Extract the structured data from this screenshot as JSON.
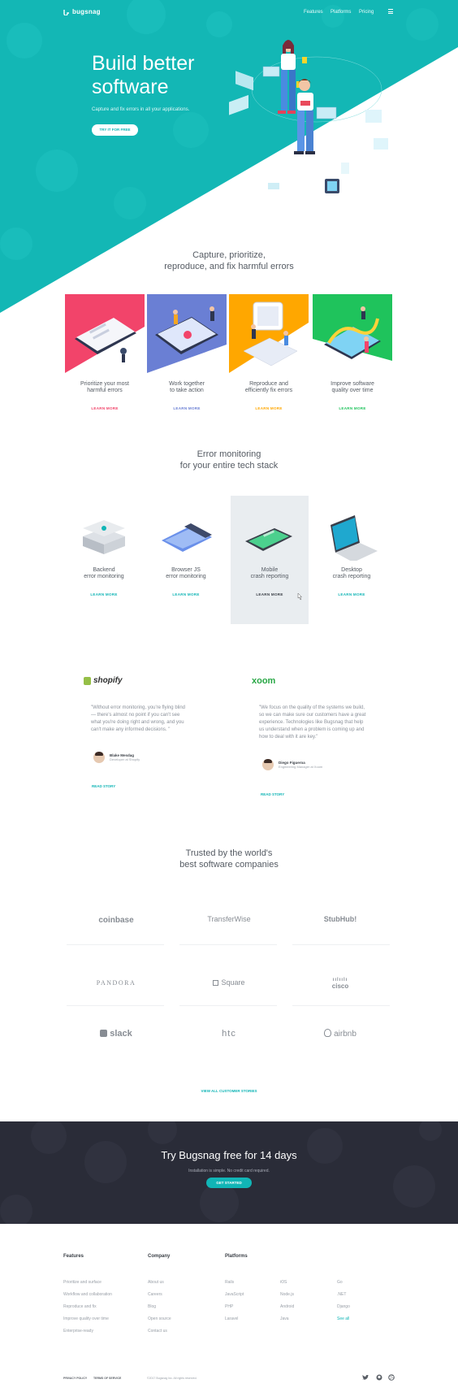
{
  "brand": {
    "name": "bugsnag",
    "accent": "#11b5b6",
    "dark": "#2a2c38"
  },
  "nav": {
    "links": [
      "Features",
      "Platforms",
      "Pricing"
    ],
    "menu_icon": "mail-icon"
  },
  "hero": {
    "title_line1": "Build better",
    "title_line2": "software",
    "subtitle": "Capture and fix errors in all your applications.",
    "cta": "TRY IT FOR FREE"
  },
  "features_section": {
    "title_line1": "Capture, prioritize,",
    "title_line2": "reproduce, and fix harmful errors"
  },
  "features": [
    {
      "line1": "Prioritize your most",
      "line2": "harmful errors",
      "link": "LEARN MORE",
      "color": "#f2446a"
    },
    {
      "line1": "Work together",
      "line2": "to take action",
      "link": "LEARN MORE",
      "color": "#6a7fd4"
    },
    {
      "line1": "Reproduce and",
      "line2": "efficiently fix errors",
      "link": "LEARN MORE",
      "color": "#ffa700"
    },
    {
      "line1": "Improve software",
      "line2": "quality over time",
      "link": "LEARN MORE",
      "color": "#1fc35c"
    }
  ],
  "tech_section": {
    "title_line1": "Error monitoring",
    "title_line2": "for your entire tech stack"
  },
  "tech": [
    {
      "line1": "Backend",
      "line2": "error monitoring",
      "link": "LEARN MORE"
    },
    {
      "line1": "Browser JS",
      "line2": "error monitoring",
      "link": "LEARN MORE"
    },
    {
      "line1": "Mobile",
      "line2": "crash reporting",
      "link": "LEARN MORE"
    },
    {
      "line1": "Desktop",
      "line2": "crash reporting",
      "link": "LEARN MORE"
    }
  ],
  "testimonials": [
    {
      "company": "shopify",
      "quote": "\"Without error monitoring, you're flying blind — there's almost no point if you can't see what you're doing right and wrong, and you can't make any informed decisions. \"",
      "name": "Blake Mesdag",
      "role": "Developer at Shopify",
      "link": "READ STORY"
    },
    {
      "company": "xoom",
      "quote": "\"We focus on the quality of the systems we build, so we can make sure our customers have a great experience. Technologies like Bugsnag that help us understand when a problem is coming up and how to deal with it are key.\"",
      "name": "Diego Figueroa",
      "role": "Engineering Manager at Xoom",
      "link": "READ STORY"
    }
  ],
  "trusted_section": {
    "title_line1": "Trusted by the world's",
    "title_line2": "best software companies"
  },
  "logos": [
    "coinbase",
    "TransferWise",
    "StubHub!",
    "PANDORA",
    "Square",
    "cisco",
    "slack",
    "htc",
    "airbnb"
  ],
  "view_all": "VIEW ALL CUSTOMER STORIES",
  "cta": {
    "title": "Try Bugsnag free for 14 days",
    "subtitle": "Installation is simple. No credit card required.",
    "button": "GET STARTED"
  },
  "footer": {
    "features_heading": "Features",
    "features": [
      "Prioritize and surface",
      "Workflow and collaboration",
      "Reproduce and fix",
      "Improve quality over time",
      "Enterprise-ready"
    ],
    "company_heading": "Company",
    "company": [
      "About us",
      "Careers",
      "Blog",
      "Open source",
      "Contact us"
    ],
    "platforms_heading": "Platforms",
    "platforms_col1": [
      "Rails",
      "JavaScript",
      "PHP",
      "Laravel"
    ],
    "platforms_col2": [
      "iOS",
      "Node.js",
      "Android",
      "Java"
    ],
    "platforms_col3": [
      "Go",
      ".NET",
      "Django",
      "See all"
    ],
    "privacy": "PRIVACY POLICY",
    "terms": "TERMS OF SERVICE",
    "copyright": "©2017 Bugsnag Inc. All rights reserved."
  }
}
